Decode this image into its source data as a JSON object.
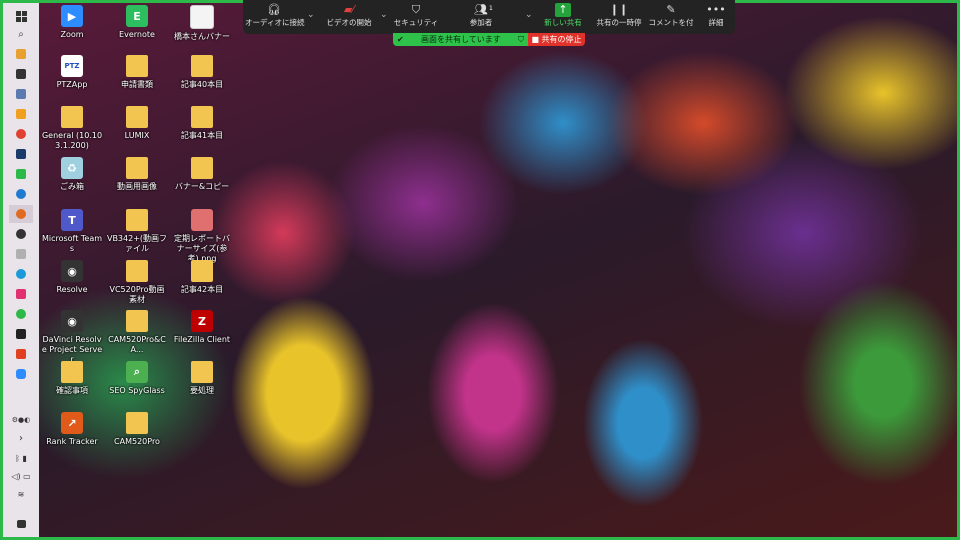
{
  "desktop": {
    "icons": [
      {
        "label": "Zoom",
        "icon": "zoom-icon",
        "color": "#2d8cff"
      },
      {
        "label": "Evernote",
        "icon": "evernote-icon",
        "color": "#2dbe60"
      },
      {
        "label": "橋本さんバナー",
        "icon": "file-icon",
        "color": "#f4f4f4"
      },
      {
        "label": "PTZApp",
        "icon": "ptzapp-icon",
        "color": "#ffffff"
      },
      {
        "label": "申請書類",
        "icon": "folder-icon",
        "color": "#f1c550"
      },
      {
        "label": "記事40本目",
        "icon": "folder-icon",
        "color": "#f1c550"
      },
      {
        "label": "General (10.103.1.200)",
        "icon": "network-folder-icon",
        "color": "#f1c550"
      },
      {
        "label": "LUMIX",
        "icon": "folder-icon",
        "color": "#f1c550"
      },
      {
        "label": "記事41本目",
        "icon": "folder-icon",
        "color": "#f1c550"
      },
      {
        "label": "ごみ箱",
        "icon": "recycle-bin-icon",
        "color": "#9fd0e0"
      },
      {
        "label": "動画用画像",
        "icon": "folder-icon",
        "color": "#f1c550"
      },
      {
        "label": "バナー&コピー",
        "icon": "folder-icon",
        "color": "#f1c550"
      },
      {
        "label": "Microsoft Teams",
        "icon": "teams-icon",
        "color": "#5059c9"
      },
      {
        "label": "VB342+(動画ファイル",
        "icon": "folder-icon",
        "color": "#f1c550"
      },
      {
        "label": "定期レポートバナーサイズ(参考).png",
        "icon": "image-file-icon",
        "color": "#e07070"
      },
      {
        "label": "Resolve",
        "icon": "resolve-icon",
        "color": "#333333"
      },
      {
        "label": "VC520Pro動画素材",
        "icon": "folder-icon",
        "color": "#f1c550"
      },
      {
        "label": "記事42本目",
        "icon": "folder-icon",
        "color": "#f1c550"
      },
      {
        "label": "DaVinci Resolve Project Server",
        "icon": "davinci-server-icon",
        "color": "#333333"
      },
      {
        "label": "CAM520Pro&CA...",
        "icon": "folder-icon",
        "color": "#f1c550"
      },
      {
        "label": "FileZilla Client",
        "icon": "filezilla-icon",
        "color": "#bf0000"
      },
      {
        "label": "確認事項",
        "icon": "folder-icon",
        "color": "#f1c550"
      },
      {
        "label": "SEO SpyGlass",
        "icon": "seo-spyglass-icon",
        "color": "#4caf50"
      },
      {
        "label": "要処理",
        "icon": "folder-icon",
        "color": "#f1c550"
      },
      {
        "label": "Rank Tracker",
        "icon": "rank-tracker-icon",
        "color": "#e05a1a"
      },
      {
        "label": "CAM520Pro",
        "icon": "folder-icon",
        "color": "#f1c550"
      }
    ]
  },
  "zoom_toolbar": {
    "audio_label": "オーディオに接続",
    "video_label": "ビデオの開始",
    "security_label": "セキュリティ",
    "participants_label": "参加者",
    "participants_count": "1",
    "new_share_label": "新しい共有",
    "pause_share_label": "共有の一時停",
    "annotate_label": "コメントを付",
    "more_label": "詳細"
  },
  "share_status": {
    "sharing_text": "画面を共有しています",
    "stop_label": "共有の停止"
  },
  "colors": {
    "share_green": "#2fc24a",
    "stop_red": "#e0322b",
    "toolbar_bg": "#232323",
    "border_green": "#2db84a"
  }
}
